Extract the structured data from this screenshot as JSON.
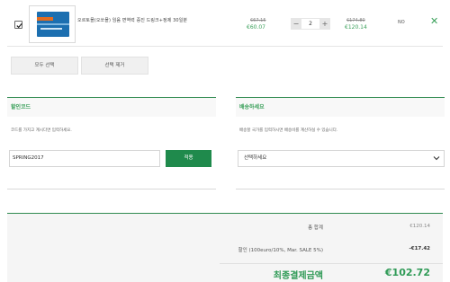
{
  "cart": {
    "item": {
      "name": "오르토몰(오쏘몰) 임움 면역력 증진 드링크+정제 30일분",
      "price_original": "€67.15",
      "price_sale": "€60.07",
      "quantity": "2",
      "total_original": "€174.80",
      "total_sale": "€120.14",
      "delivery": "NO",
      "selected": true
    }
  },
  "actions": {
    "select_all": "모두 선택",
    "remove_selected": "선택 제거"
  },
  "coupon": {
    "title": "할인코드",
    "description": "코드를 가지고 계시다면 입력하세요.",
    "value": "SPRING2017",
    "apply": "적용"
  },
  "shipping": {
    "title": "배송하세요",
    "description": "배송할 국가를 입력하시면 배송비를 계산하실 수 있습니다.",
    "select_value": "선택하세요"
  },
  "summary": {
    "total_label": "총 합계",
    "total_value": "€120.14",
    "discount_label": "할인 (100euro/10%, Mar. SALE 5%)",
    "discount_value": "-€17.42",
    "final_label": "최종결제금액",
    "final_value": "€102.72"
  },
  "colors": {
    "accent": "#3aa05a",
    "button": "#1f8a4c"
  }
}
